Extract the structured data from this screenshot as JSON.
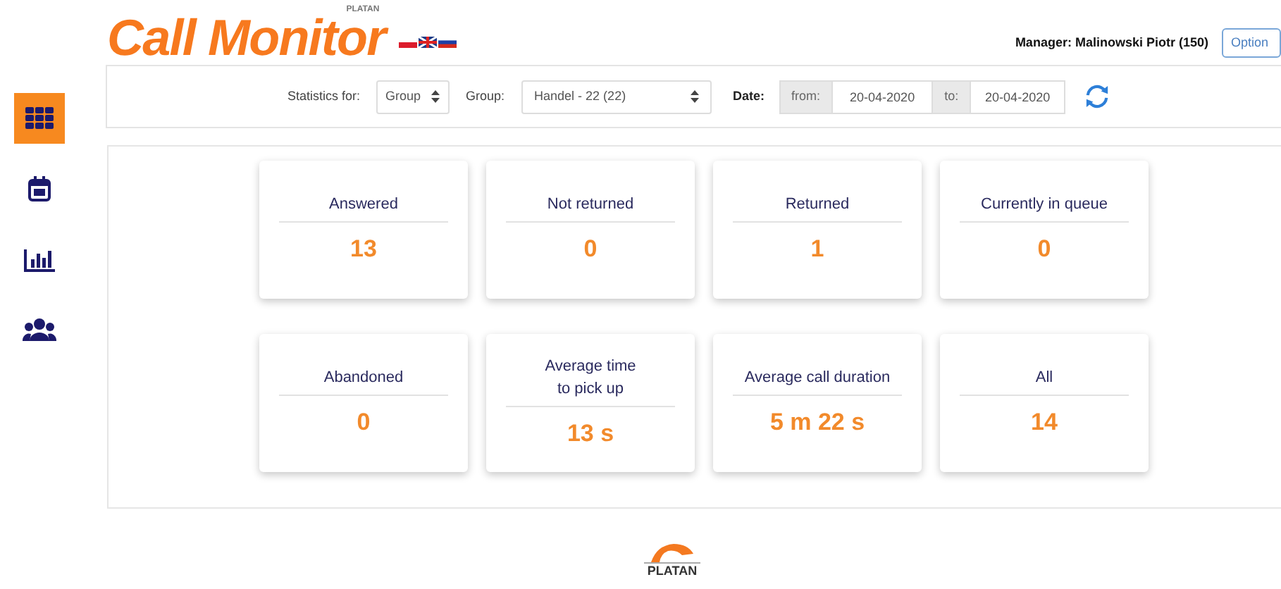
{
  "header": {
    "logo": "Call Monitor",
    "logo_brand": "PLATAN",
    "manager": "Manager: Malinowski Piotr (150)",
    "options_button": "Option"
  },
  "sidebar": {
    "items": [
      {
        "kind": "dashboard",
        "selected": true
      },
      {
        "kind": "calendar",
        "selected": false
      },
      {
        "kind": "chart",
        "selected": false
      },
      {
        "kind": "users",
        "selected": false
      }
    ]
  },
  "filters": {
    "statistics_label": "Statistics for:",
    "statistics_value": "Group",
    "group_label": "Group:",
    "group_value": "Handel - 22 (22)",
    "date_label": "Date:",
    "from_label": "from:",
    "from_value": "20-04-2020",
    "to_label": "to:",
    "to_value": "20-04-2020"
  },
  "cards": [
    {
      "title": "Answered",
      "value": "13"
    },
    {
      "title": "Not returned",
      "value": "0"
    },
    {
      "title": "Returned",
      "value": "1"
    },
    {
      "title": "Currently in queue",
      "value": "0"
    },
    {
      "title": "Abandoned",
      "value": "0"
    },
    {
      "title": "Average time\nto pick up",
      "value": "13 s"
    },
    {
      "title": "Average call duration",
      "value": "5 m 22 s"
    },
    {
      "title": "All",
      "value": "14"
    }
  ],
  "footer": {
    "logo": "PLATAN"
  }
}
